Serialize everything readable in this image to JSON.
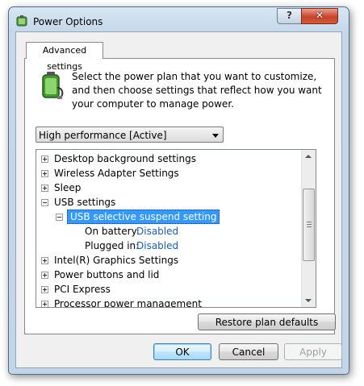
{
  "window": {
    "title": "Power Options",
    "help_label": "?",
    "close_label": "✕"
  },
  "tab": {
    "label": "Advanced settings"
  },
  "intro": {
    "text": "Select the power plan that you want to customize, and then choose settings that reflect how you want your computer to manage power."
  },
  "plan_select": {
    "value": "High performance [Active]"
  },
  "tree": {
    "items": [
      {
        "label": "Desktop background settings"
      },
      {
        "label": "Wireless Adapter Settings"
      },
      {
        "label": "Sleep"
      },
      {
        "label": "USB settings"
      },
      {
        "label": "USB selective suspend setting"
      },
      {
        "label": "On battery:",
        "value": "Disabled"
      },
      {
        "label": "Plugged in:",
        "value": "Disabled"
      },
      {
        "label": "Intel(R) Graphics Settings"
      },
      {
        "label": "Power buttons and lid"
      },
      {
        "label": "PCI Express"
      },
      {
        "label": "Processor power management"
      }
    ]
  },
  "buttons": {
    "restore": "Restore plan defaults",
    "ok": "OK",
    "cancel": "Cancel",
    "apply": "Apply"
  },
  "colors": {
    "selection": "#3399ff",
    "link_value": "#1b5cb8",
    "close_button": "#c8432c"
  }
}
